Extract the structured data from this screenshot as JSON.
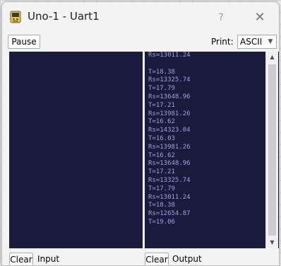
{
  "window": {
    "title": "Uno-1 - Uart1",
    "help_symbol": "?",
    "close_symbol": "✕",
    "app_icon": "uart-device-icon"
  },
  "toolbar": {
    "pause_label": "Pause",
    "print_label": "Print:",
    "print_value": "ASCII"
  },
  "output": {
    "lines": [
      "Rs=13011.24",
      "",
      "T=18.38",
      "Rs=13325.74",
      "T=17.79",
      "Rs=13648.96",
      "T=17.21",
      "Rs=13981.26",
      "T=16.62",
      "Rs=14323.04",
      "T=16.03",
      "Rs=13981.26",
      "T=16.62",
      "Rs=13648.96",
      "T=17.21",
      "Rs=13325.74",
      "T=17.79",
      "Rs=13011.24",
      "T=18.38",
      "Rs=12654.87",
      "T=19.06"
    ]
  },
  "footer": {
    "clear_input_label": "Clear",
    "input_label": "Input",
    "clear_output_label": "Clear",
    "output_label": "Output"
  },
  "colors": {
    "console_bg": "#1a1a3c",
    "console_text": "#9f9fe8"
  }
}
